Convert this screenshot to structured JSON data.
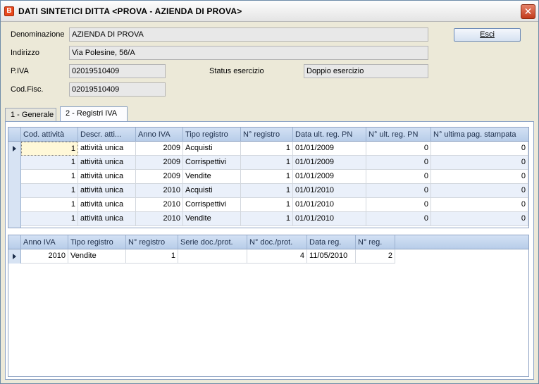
{
  "window": {
    "title": "DATI SINTETICI DITTA <PROVA - AZIENDA DI PROVA>",
    "close_glyph": "✕",
    "app_icon_glyph": "B"
  },
  "form": {
    "denominazione_label": "Denominazione",
    "denominazione_value": "AZIENDA DI PROVA",
    "indirizzo_label": "Indirizzo",
    "indirizzo_value": "Via Polesine, 56/A",
    "piva_label": "P.IVA",
    "piva_value": "02019510409",
    "status_label": "Status esercizio",
    "status_value": "Doppio esercizio",
    "codfisc_label": "Cod.Fisc.",
    "codfisc_value": "02019510409",
    "esci_label": "Esci"
  },
  "tabs": [
    {
      "label": "1 - Generale",
      "active": false
    },
    {
      "label": "2 - Registri IVA",
      "active": true
    }
  ],
  "registri_grid": {
    "columns": [
      "Cod. attività",
      "Descr. atti...",
      "Anno IVA",
      "Tipo registro",
      "N° registro",
      "Data ult. reg. PN",
      "N° ult. reg. PN",
      "N° ultima pag. stampata"
    ],
    "rows": [
      [
        "1",
        "attività unica",
        "2009",
        "Acquisti",
        "1",
        "01/01/2009",
        "0",
        "0"
      ],
      [
        "1",
        "attività unica",
        "2009",
        "Corrispettivi",
        "1",
        "01/01/2009",
        "0",
        "0"
      ],
      [
        "1",
        "attività unica",
        "2009",
        "Vendite",
        "1",
        "01/01/2009",
        "0",
        "0"
      ],
      [
        "1",
        "attività unica",
        "2010",
        "Acquisti",
        "1",
        "01/01/2010",
        "0",
        "0"
      ],
      [
        "1",
        "attività unica",
        "2010",
        "Corrispettivi",
        "1",
        "01/01/2010",
        "0",
        "0"
      ],
      [
        "1",
        "attività unica",
        "2010",
        "Vendite",
        "1",
        "01/01/2010",
        "0",
        "0"
      ]
    ]
  },
  "dettaglio_grid": {
    "columns": [
      "Anno IVA",
      "Tipo registro",
      "N° registro",
      "Serie doc./prot.",
      "N° doc./prot.",
      "Data reg.",
      "N° reg."
    ],
    "rows": [
      [
        "2010",
        "Vendite",
        "1",
        "",
        "4",
        "11/05/2010",
        "2"
      ]
    ]
  }
}
